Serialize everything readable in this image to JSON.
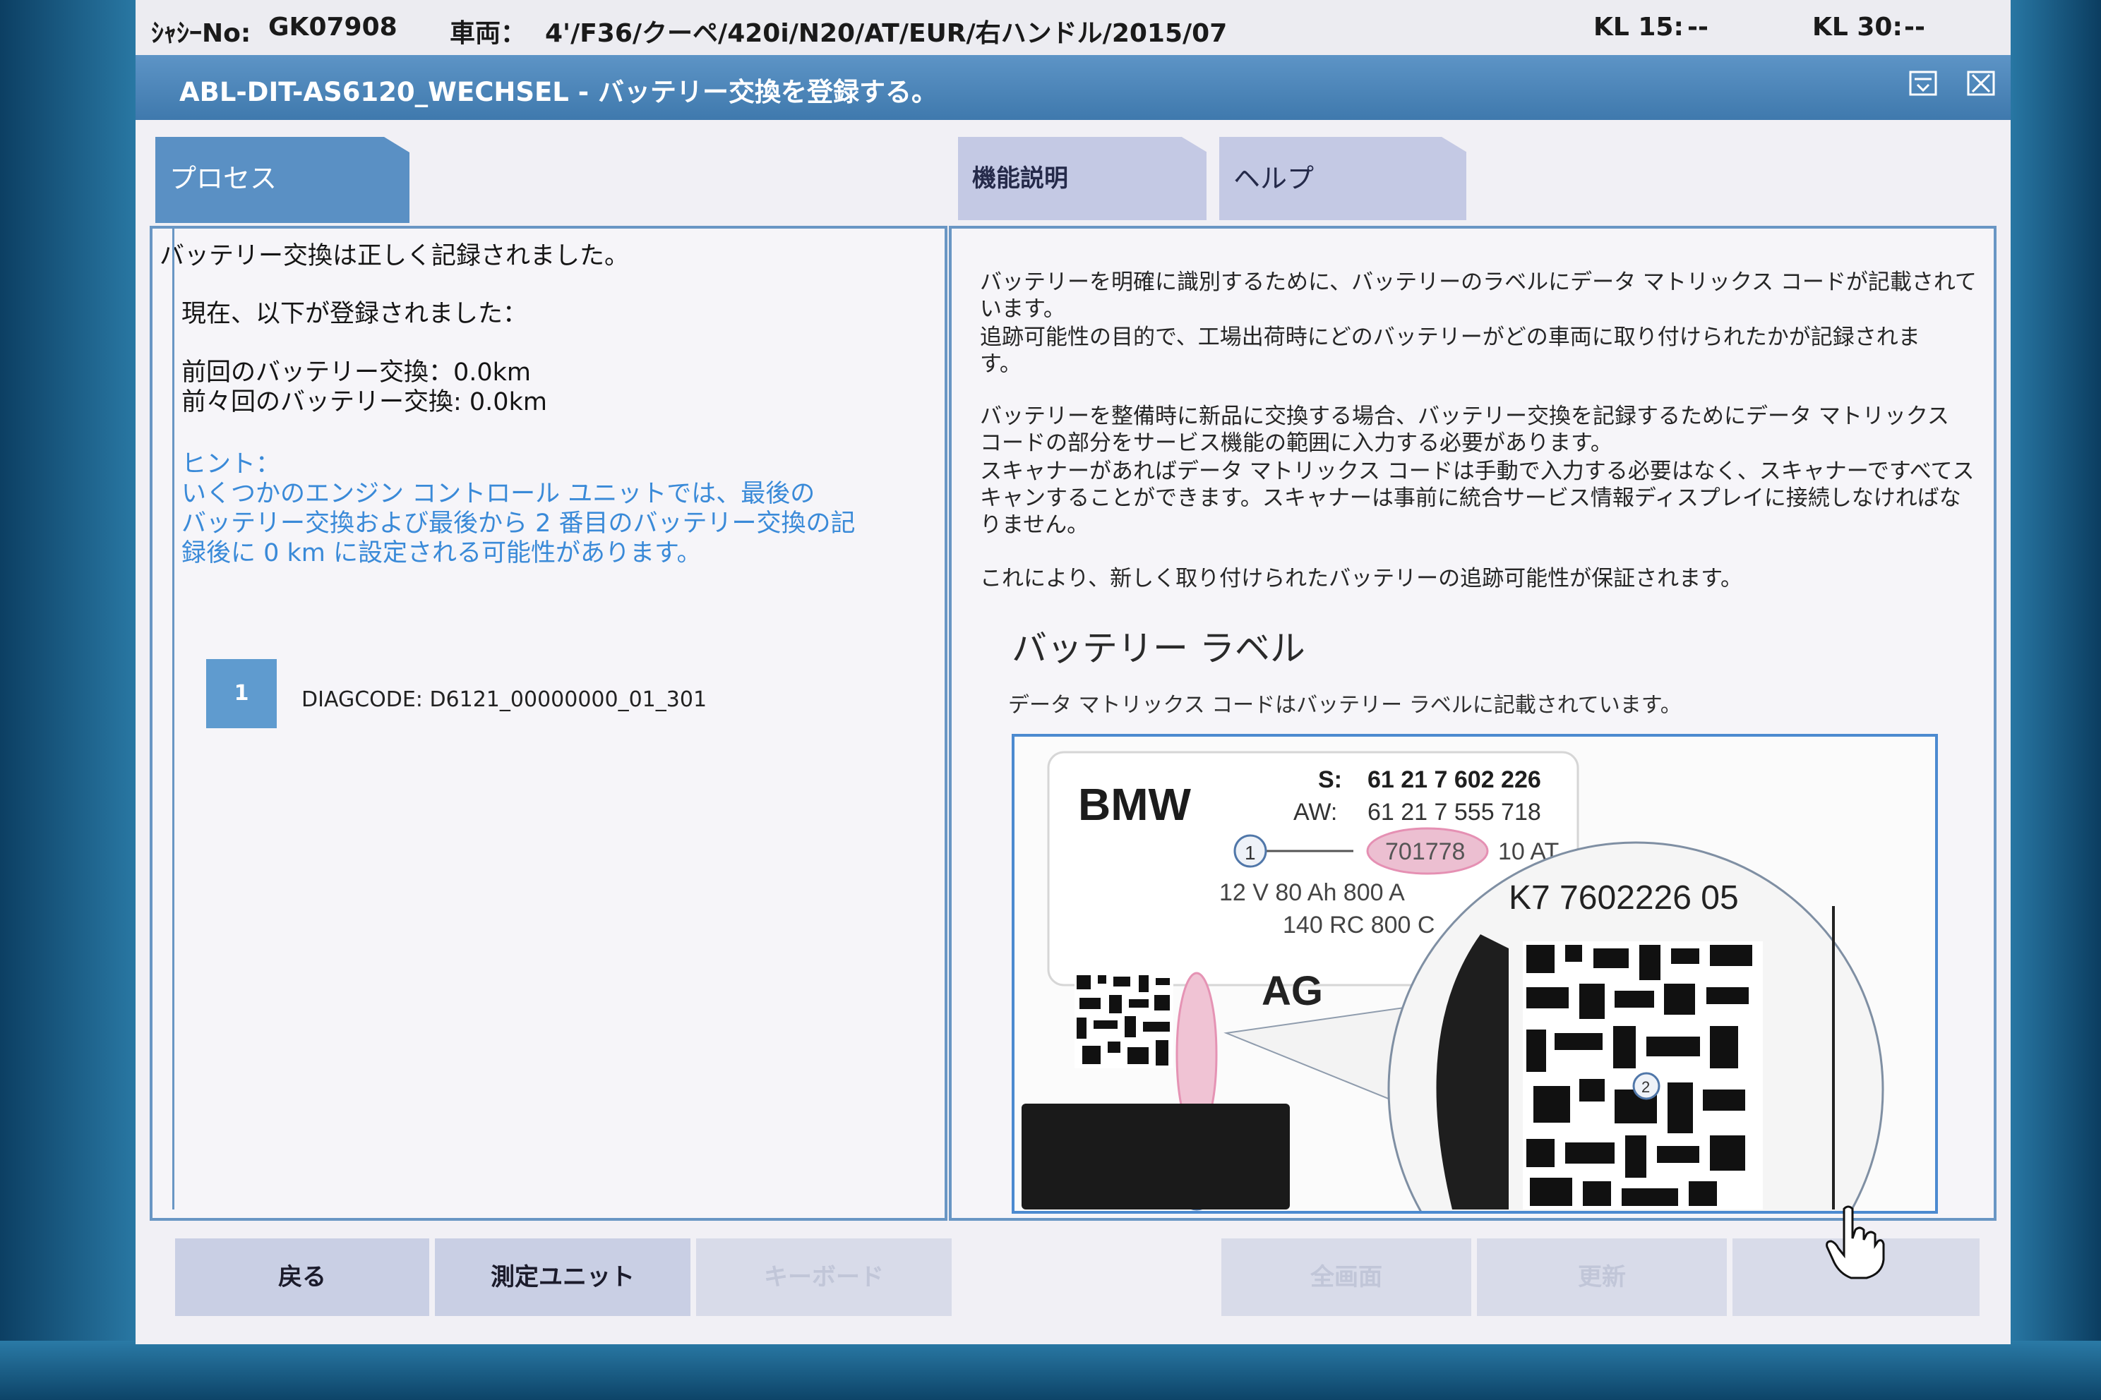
{
  "header": {
    "chassis_label": "ｼｬｼｰNo:",
    "chassis_value": "GK07908",
    "vehicle_label": "車両：",
    "vehicle_value": "4'/F36/クーペ/420i/N20/AT/EUR/右ハンドル/2015/07",
    "kl15_label": "KL 15:",
    "kl15_value": "--",
    "kl30_label": "KL 30:",
    "kl30_value": "--"
  },
  "window": {
    "title": "ABL-DIT-AS6120_WECHSEL  -  バッテリー交換を登録する。",
    "icons": [
      "minimize-icon",
      "close-icon"
    ]
  },
  "tabs": {
    "process": "プロセス",
    "function_description": "機能説明",
    "help": "ヘルプ"
  },
  "process": {
    "line1": "バッテリー交換は正しく記録されました。",
    "line2": "現在、以下が登録されました：",
    "line3": "前回のバッテリー交換：0.0km",
    "line4": "前々回のバッテリー交換: 0.0km",
    "hint_title": "ヒント：",
    "hint_line1": "いくつかのエンジン コントロール ユニットでは、最後の",
    "hint_line2": "バッテリー交換および最後から 2 番目のバッテリー交換の記",
    "hint_line3": "録後に 0 km に設定される可能性があります。",
    "diag_number": "1",
    "diag_code": "DIAGCODE: D6121_00000000_01_301"
  },
  "description": {
    "p1_l1": "バッテリーを明確に識別するために、バッテリーのラベルにデータ マトリックス コードが記載されて",
    "p1_l2": "います。",
    "p1_l3": "追跡可能性の目的で、工場出荷時にどのバッテリーがどの車両に取り付けられたかが記録されま",
    "p1_l4": "す。",
    "p2_l1": "バッテリーを整備時に新品に交換する場合、バッテリー交換を記録するためにデータ マトリックス",
    "p2_l2": "コードの部分をサービス機能の範囲に入力する必要があります。",
    "p2_l3": "スキャナーがあればデータ マトリックス コードは手動で入力する必要はなく、スキャナーですべてス",
    "p2_l4": "キャンすることができます。スキャナーは事前に統合サービス情報ディスプレイに接続しなければな",
    "p2_l5": "りません。",
    "p3_l1": "これにより、新しく取り付けられたバッテリーの追跡可能性が保証されます。",
    "heading": "バッテリー ラベル",
    "subheading": "データ マトリックス コードはバッテリー ラベルに記載されています。"
  },
  "battery_label": {
    "brand": "BMW",
    "s_label": "S:",
    "s_value": "61 21 7 602 226",
    "aw_label": "AW:",
    "aw_value": "61 21 7 555 718",
    "callout_1": "1",
    "callout_2": "2",
    "circled_code": "701778",
    "at_text": "10 AT",
    "spec_line1": "12 V  80 Ah   800 A",
    "spec_line2": "140 RC 800 C",
    "zoom_code": "K7 7602226 05",
    "ag_text": "AG"
  },
  "buttons": {
    "back": "戻る",
    "measure_unit": "測定ユニット",
    "keyboard": "キーボード",
    "fullscreen": "全画面",
    "update": "更新",
    "blank": ""
  }
}
